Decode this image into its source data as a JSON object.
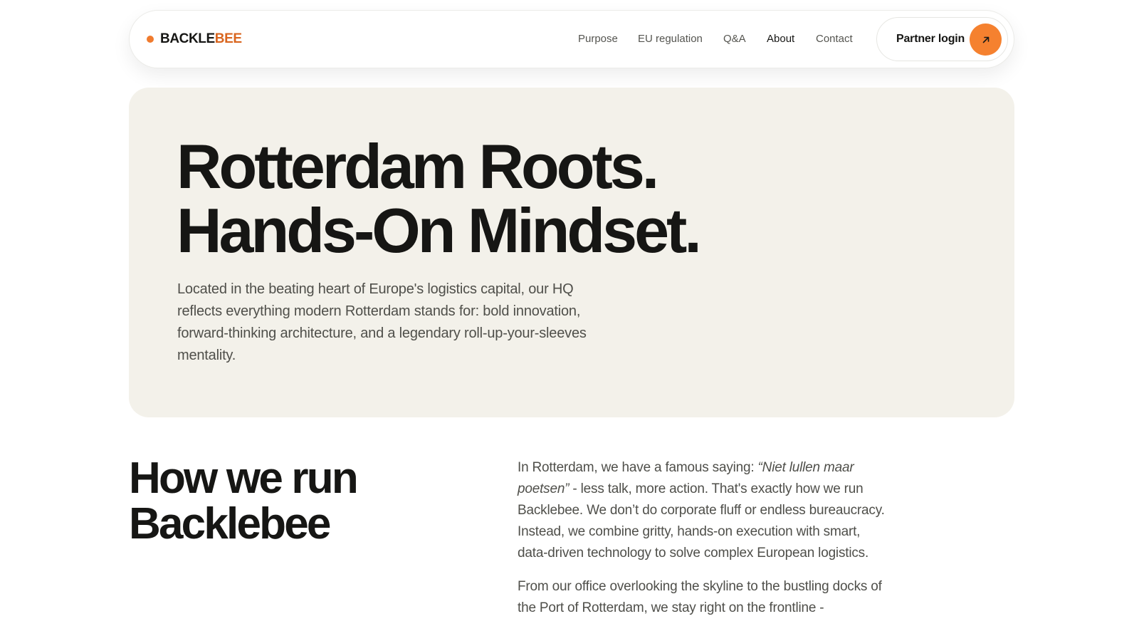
{
  "nav": {
    "brand_part1": "BACKLE",
    "brand_part2": "BEE",
    "links": [
      {
        "label": "Purpose"
      },
      {
        "label": "EU regulation"
      },
      {
        "label": "Q&A"
      },
      {
        "label": "About",
        "active": true
      },
      {
        "label": "Contact"
      }
    ],
    "login_label": "Partner login",
    "login_icon": "arrow-up-right-icon"
  },
  "hero": {
    "title_line1": "Rotterdam Roots.",
    "title_line2": "Hands-On Mindset.",
    "description": "Located in the beating heart of Europe's logistics capital, our HQ reflects everything modern Rotterdam stands for: bold innovation, forward-thinking architecture, and a legendary roll-up-your-sleeves mentality."
  },
  "section": {
    "title_line1": "How we run",
    "title_line2": "Backlebee",
    "para1_prefix": "In Rotterdam, we have a famous saying: ",
    "para1_quote": "“Niet lullen maar poetsen”",
    "para1_suffix": " - less talk, more action. That's exactly how we run Backlebee. We don’t do corporate fluff or endless bureaucracy. Instead, we combine gritty, hands-on execution with smart, data-driven technology to solve complex European logistics.",
    "para2": "From our office overlooking the skyline to the bustling docks of the Port of Rotterdam, we stay right on the frontline -"
  },
  "colors": {
    "accent": "#f5812f",
    "brand_orange": "#d9651f",
    "hero_bg": "#f3f1ea",
    "text_dark": "#161614",
    "text_body": "#4f4f4a"
  }
}
